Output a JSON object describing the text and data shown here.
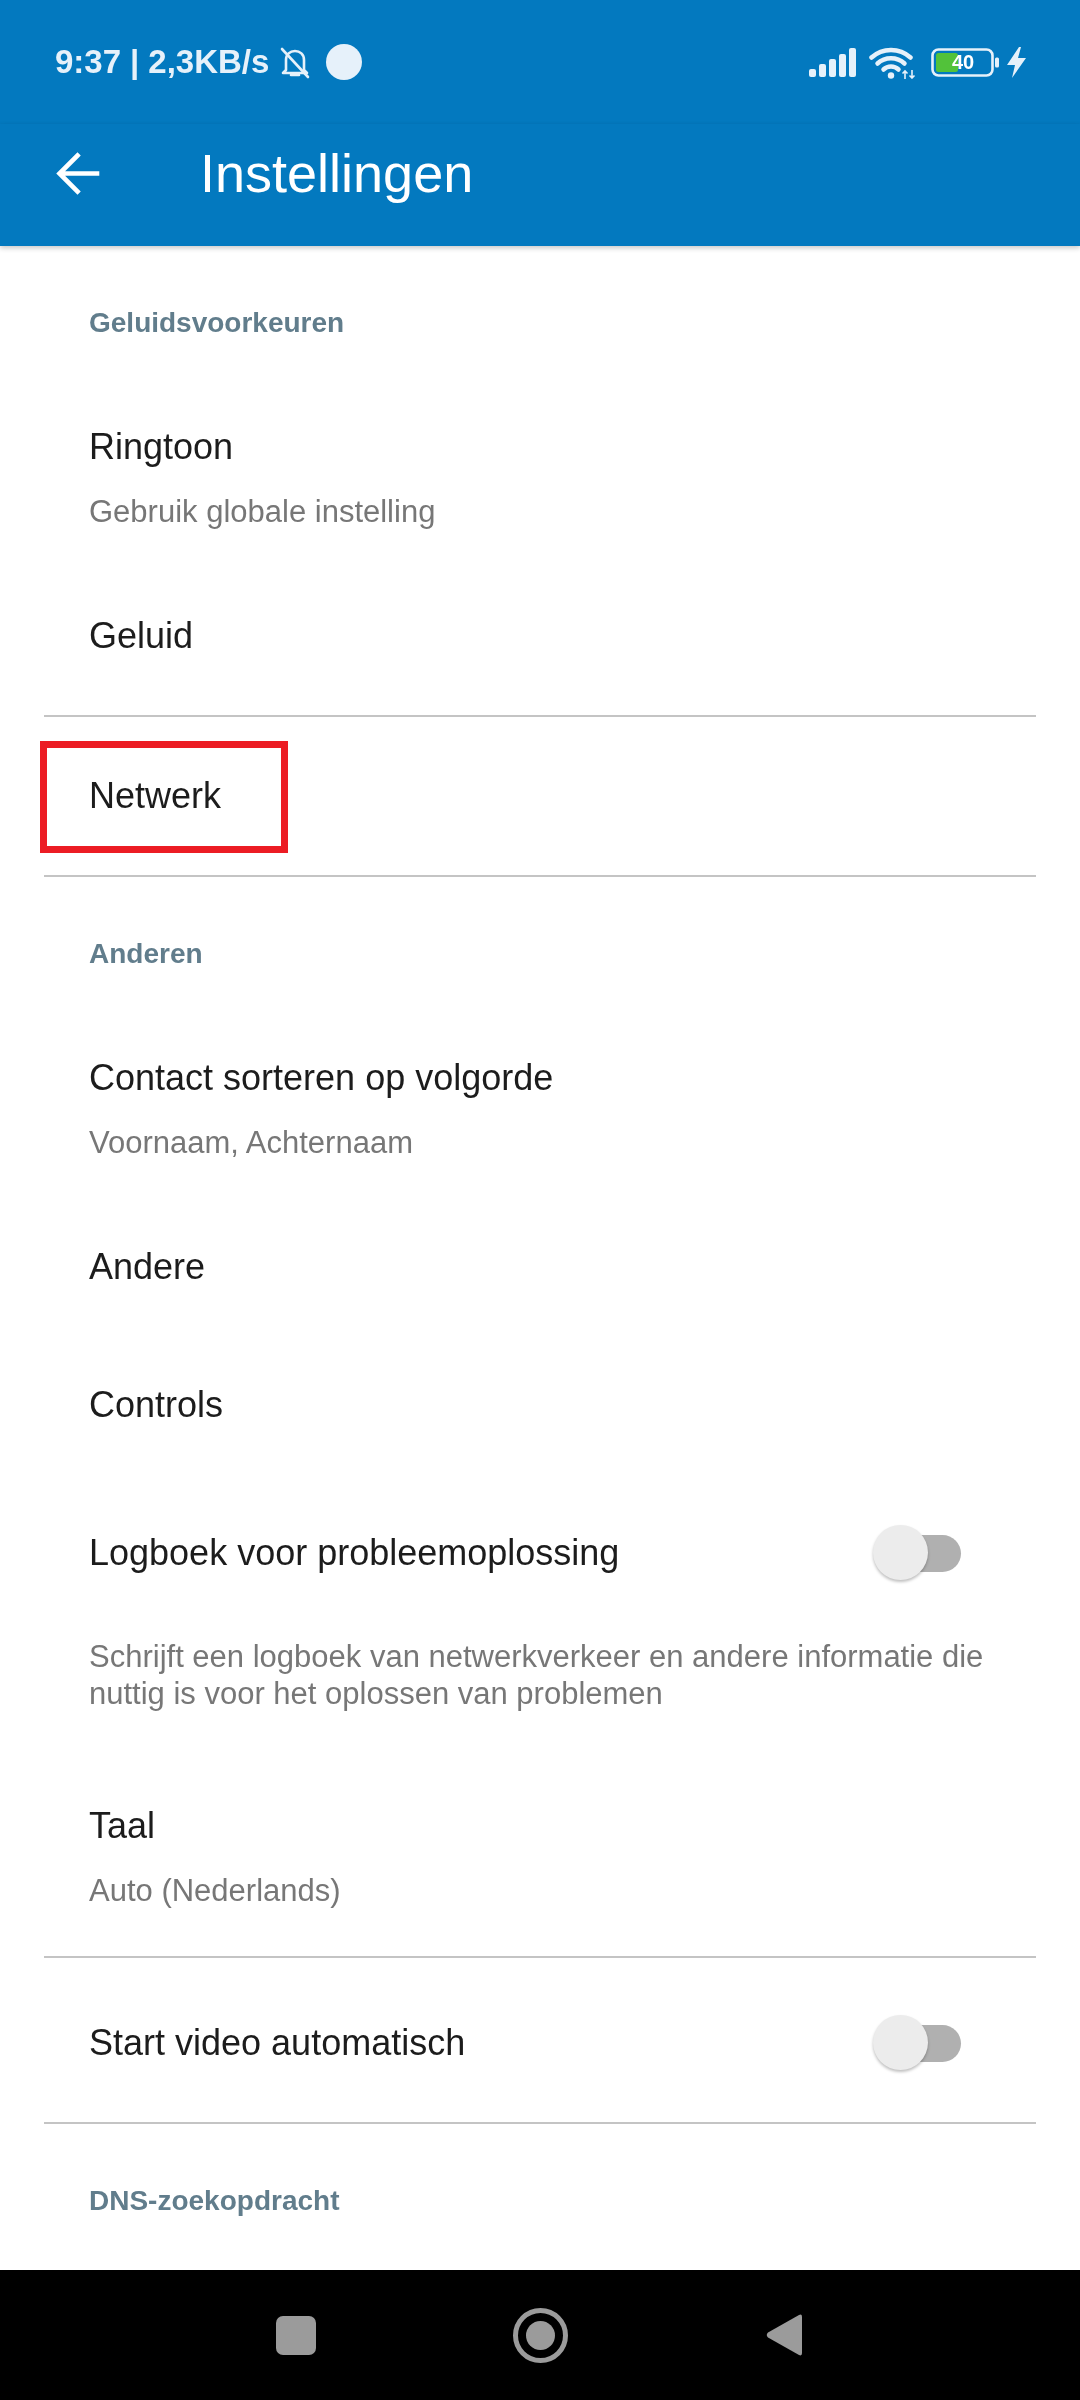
{
  "status_bar": {
    "time": "9:37",
    "separator": "|",
    "network_speed": "2,3KB/s",
    "battery": "40"
  },
  "app_bar": {
    "title": "Instellingen"
  },
  "groups": [
    {
      "header": "Geluidsvoorkeuren",
      "items": [
        {
          "kind": "text",
          "title": "Ringtoon",
          "summary": "Gebruik globale instelling",
          "highlighted": false
        },
        {
          "kind": "text",
          "title": "Geluid",
          "highlighted": false
        }
      ]
    },
    {
      "items": [
        {
          "kind": "text",
          "title": "Netwerk",
          "highlighted": true
        }
      ]
    },
    {
      "header": "Anderen",
      "items": [
        {
          "kind": "text",
          "title": "Contact sorteren op volgorde",
          "summary": "Voornaam, Achternaam",
          "highlighted": false
        },
        {
          "kind": "text",
          "title": "Andere",
          "highlighted": false
        },
        {
          "kind": "text",
          "title": "Controls",
          "highlighted": false
        },
        {
          "kind": "switch",
          "title": "Logboek voor probleemoplossing",
          "summary": "Schrijft een logboek van netwerkverkeer en andere informatie die nuttig is voor het oplossen van problemen",
          "on": false,
          "highlighted": false
        },
        {
          "kind": "text",
          "title": "Taal",
          "summary": "Auto (Nederlands)",
          "highlighted": false
        }
      ]
    },
    {
      "items": [
        {
          "kind": "switch",
          "title": "Start video automatisch",
          "on": false,
          "highlighted": false
        }
      ]
    },
    {
      "header": "DNS-zoekopdracht"
    }
  ]
}
